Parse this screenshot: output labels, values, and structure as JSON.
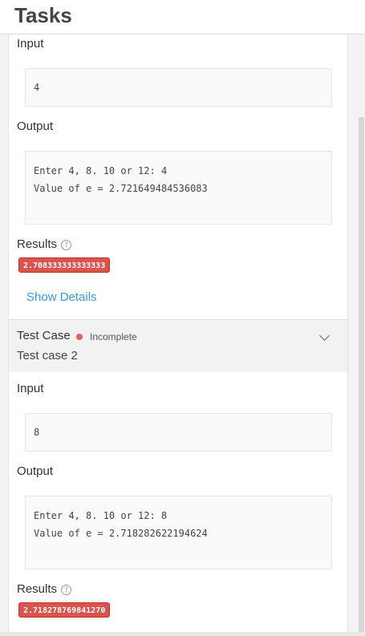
{
  "header": {
    "title": "Tasks"
  },
  "case1": {
    "input_label": "Input",
    "input_value": "4",
    "output_label": "Output",
    "output_text": "Enter 4, 8. 10 or 12: 4\nValue of e = 2.721649484536083",
    "results_label": "Results",
    "help_glyph": "?",
    "result_badge": "2.708333333333333",
    "show_details": "Show Details"
  },
  "case2": {
    "title": "Test Case",
    "status": "Incomplete",
    "name": "Test case 2",
    "input_label": "Input",
    "input_value": "8",
    "output_label": "Output",
    "output_text": "Enter 4, 8. 10 or 12: 8\nValue of e = 2.718282622194624",
    "results_label": "Results",
    "help_glyph": "?",
    "result_badge": "2.718278769841270"
  },
  "colors": {
    "badge": "#d9534f",
    "link": "#3a9ad9",
    "status_dot": "#e5605b"
  }
}
